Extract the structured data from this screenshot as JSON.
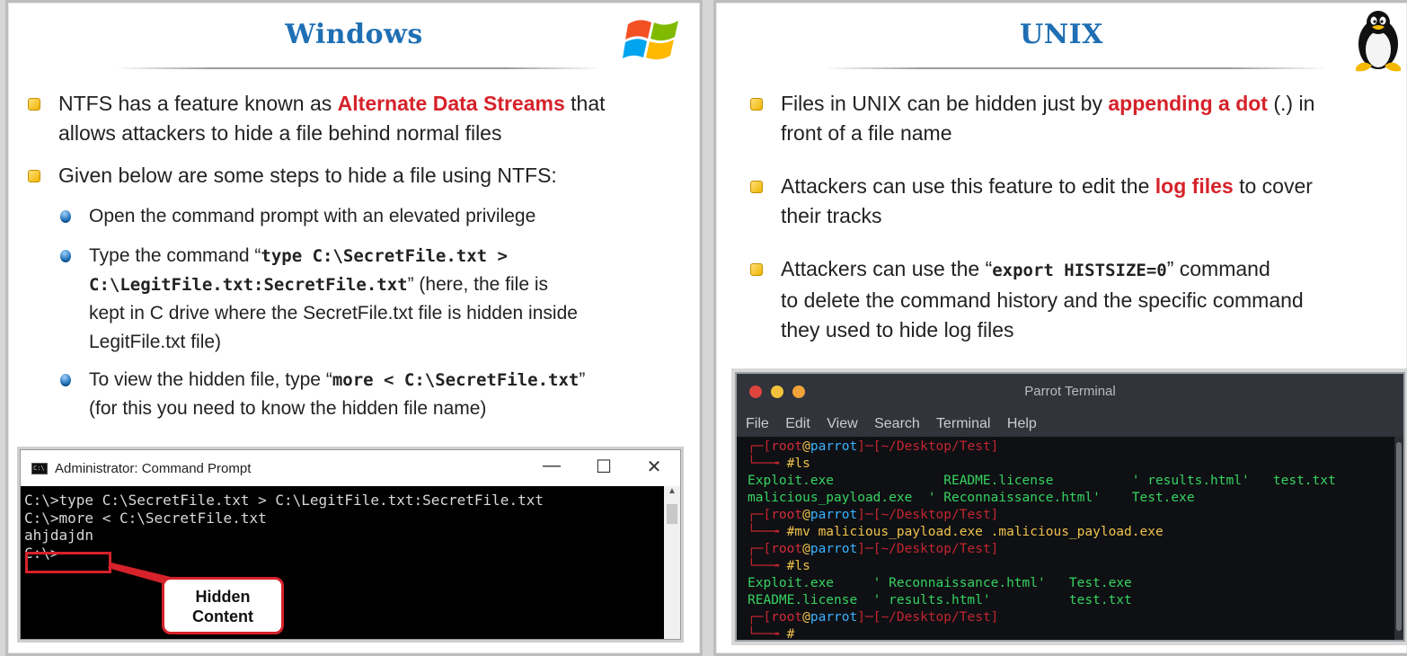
{
  "left": {
    "title": "Windows",
    "bullet1_pre": "NTFS has a feature known as ",
    "bullet1_hl": "Alternate Data Streams",
    "bullet1_post": " that",
    "bullet1_line2": "allows attackers to hide a file behind normal files",
    "bullet2": "Given below are some steps to hide a file using NTFS:",
    "sub1": "Open the command prompt with an elevated privilege",
    "sub2_pre": "Type the command “",
    "sub2_code1": "type C:\\SecretFile.txt >",
    "sub2_code2": "C:\\LegitFile.txt:SecretFile.txt",
    "sub2_mid": "” (here, the file is",
    "sub2_line3": "kept in C drive where the SecretFile.txt file is hidden inside",
    "sub2_line4": "LegitFile.txt file)",
    "sub3_pre": "To view the hidden file, type “",
    "sub3_code": "more < C:\\SecretFile.txt",
    "sub3_post": "”",
    "sub3_line2": "(for this you need to know the hidden file name)",
    "cmd": {
      "title": "Administrator: Command Prompt",
      "minimize": "—",
      "maximize": "☐",
      "close": "✕",
      "lines": [
        "C:\\>type C:\\SecretFile.txt > C:\\LegitFile.txt:SecretFile.txt",
        "",
        "C:\\>more < C:\\SecretFile.txt",
        "ahjdajdn",
        "",
        "C:\\>"
      ],
      "callout_line1": "Hidden",
      "callout_line2": "Content"
    }
  },
  "right": {
    "title": "UNIX",
    "bullet1_pre": "Files in UNIX can be hidden just by ",
    "bullet1_hl": "appending a dot",
    "bullet1_post": " (.) in",
    "bullet1_line2": "front of a file name",
    "bullet2_pre": "Attackers can use this feature to edit the ",
    "bullet2_hl": "log files",
    "bullet2_post": " to cover",
    "bullet2_line2": "their tracks",
    "bullet3_pre": "Attackers can use the “",
    "bullet3_code": "export HISTSIZE=0",
    "bullet3_post": "”  command",
    "bullet3_line2": "to delete the command history and the specific command",
    "bullet3_line3": "they used to hide log files",
    "terminal": {
      "title": "Parrot Terminal",
      "menu": [
        "File",
        "Edit",
        "View",
        "Search",
        "Terminal",
        "Help"
      ],
      "prompt_user": "root",
      "prompt_at": "@",
      "prompt_host": "parrot",
      "prompt_path": "~/Desktop/Test",
      "cmd1": "#ls",
      "out1a": "Exploit.exe              README.license          ' results.html'   test.txt",
      "out1b": "malicious_payload.exe  ' Reconnaissance.html'    Test.exe",
      "cmd2": "#mv malicious_payload.exe .malicious_payload.exe",
      "cmd3": "#ls",
      "out3a": "Exploit.exe     ' Reconnaissance.html'   Test.exe",
      "out3b": "README.license  ' results.html'          test.txt",
      "cmd4": "#"
    }
  },
  "colors": {
    "title_blue": "#1f6fb4",
    "highlight_red": "#d6222a",
    "bullet_yellow": "#f0b400"
  }
}
